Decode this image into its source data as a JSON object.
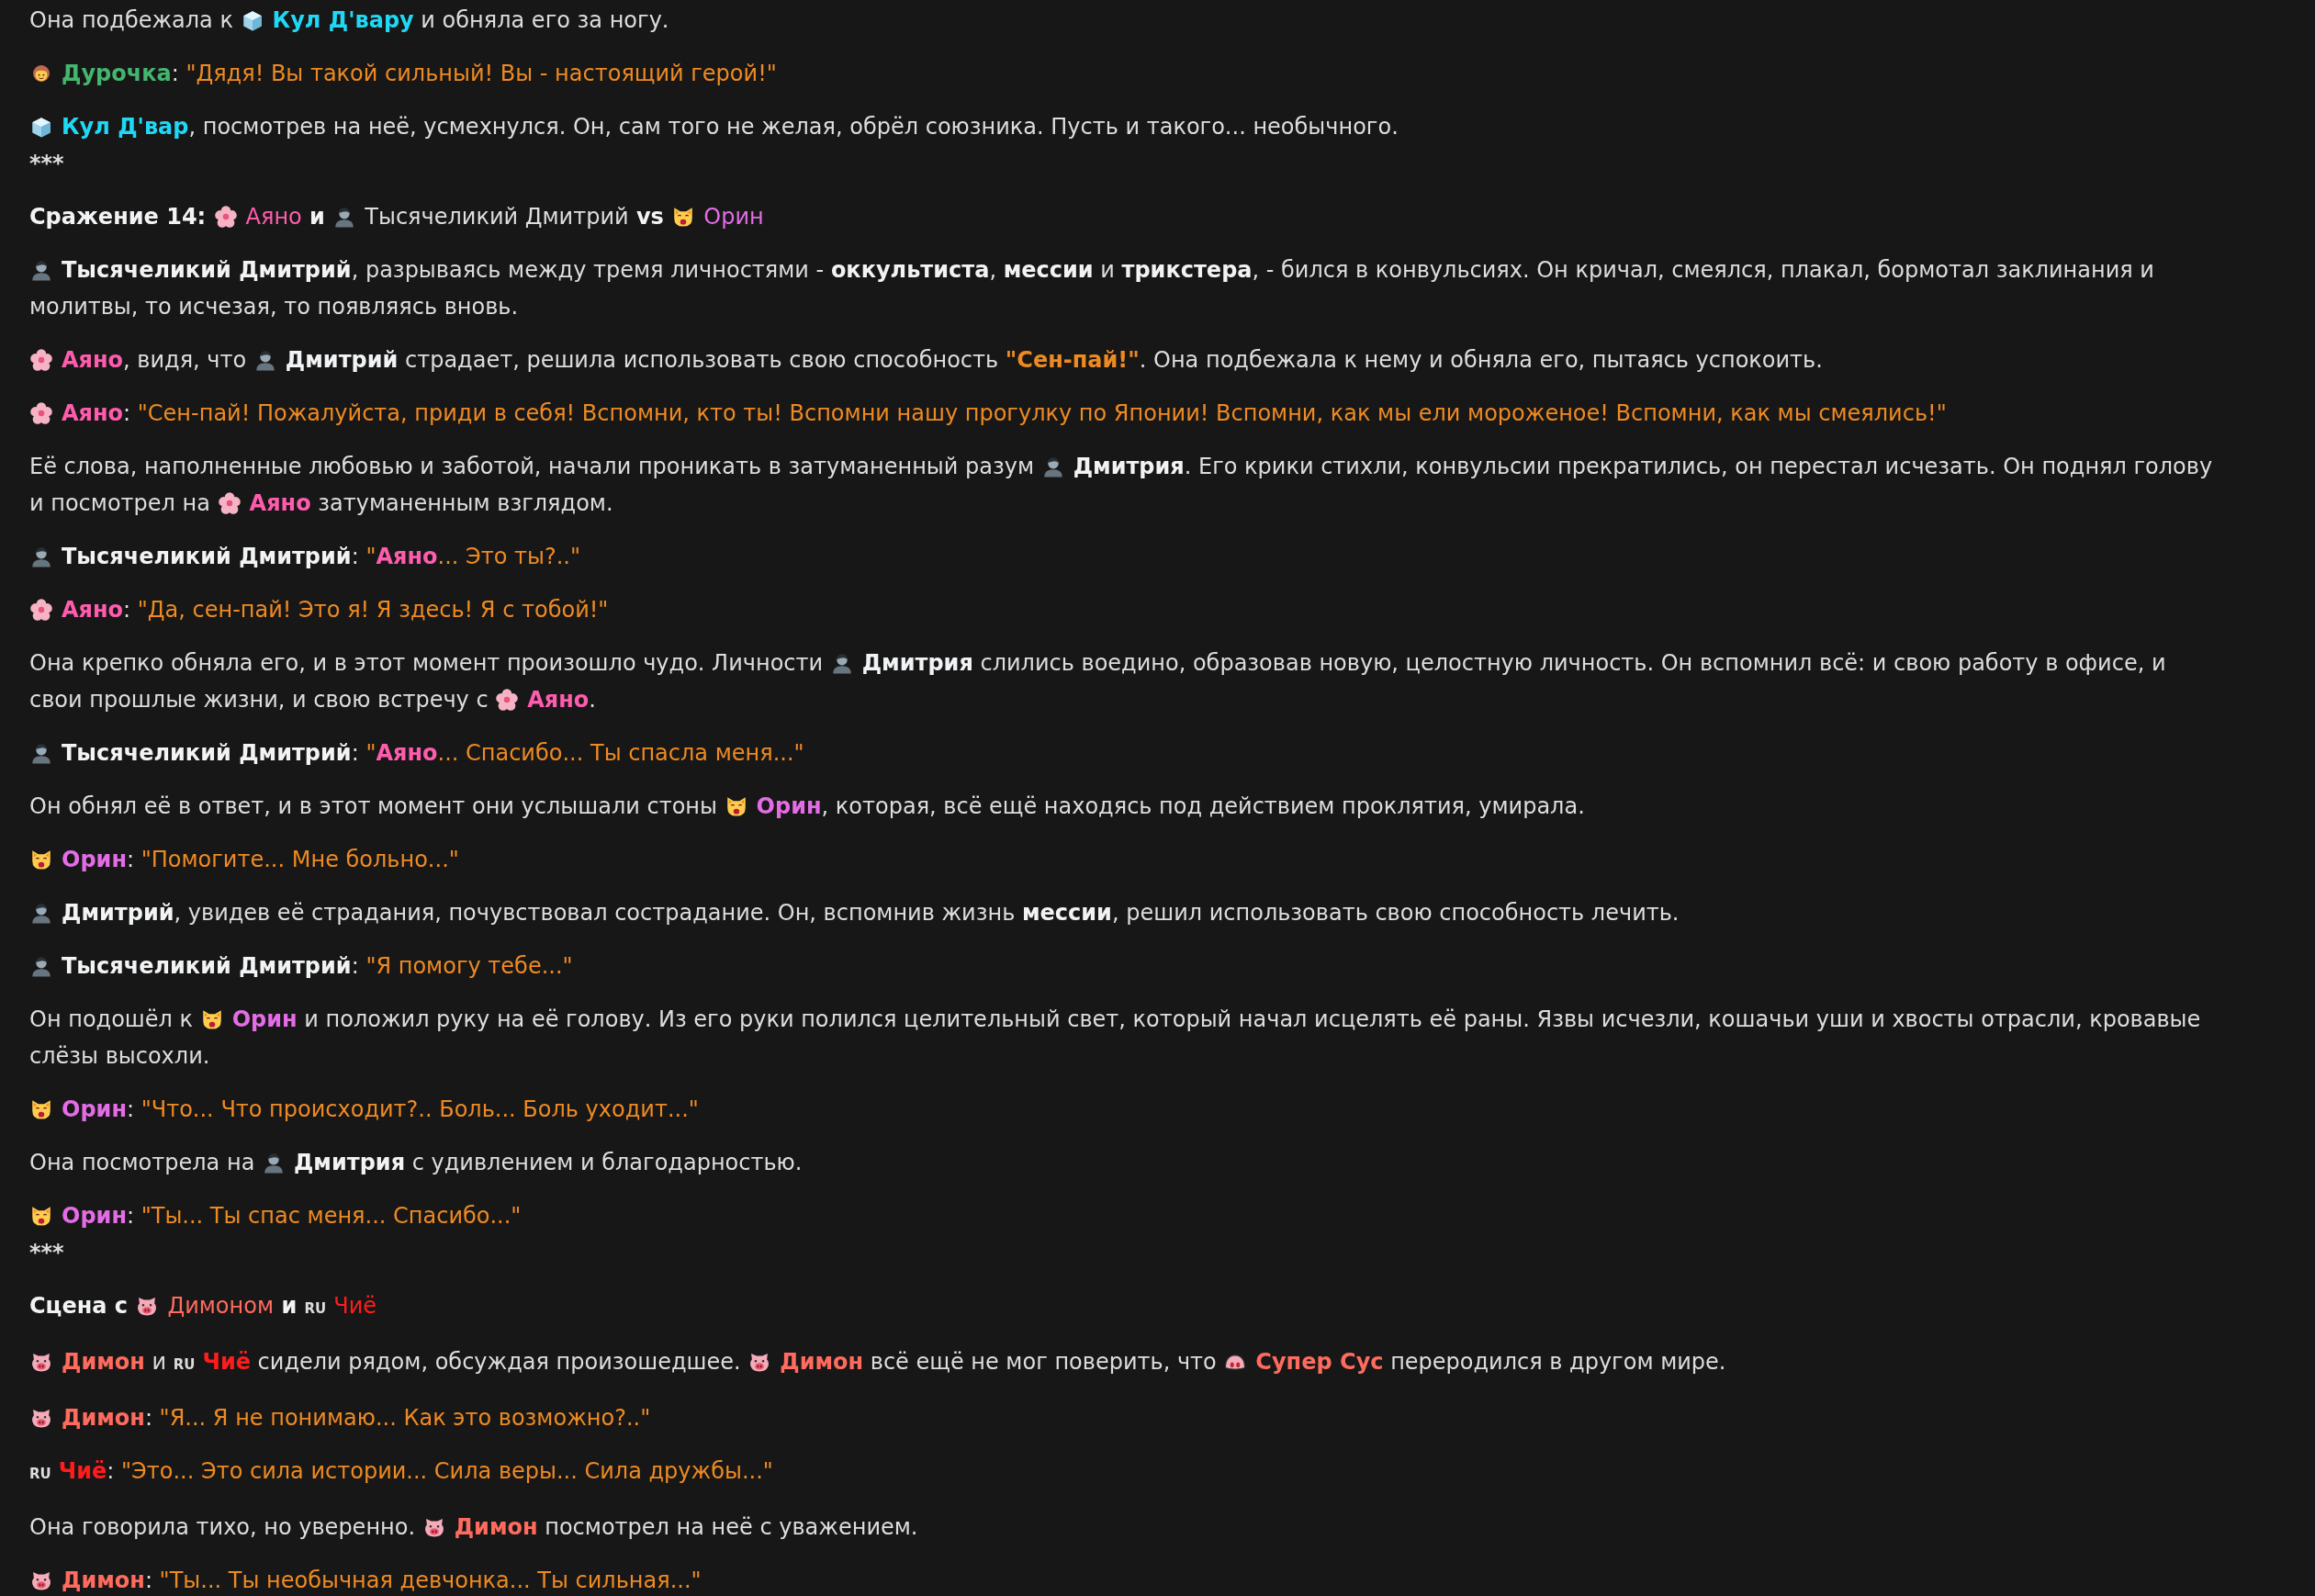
{
  "story": [
    {
      "kind": "paragraph",
      "lines": [
        [
          {
            "kind": "text",
            "text": "Она подбежала к "
          },
          {
            "kind": "ice"
          },
          {
            "kind": "name",
            "text": "Кул Д'вару",
            "color": "#1fd8f5"
          },
          {
            "kind": "text",
            "text": " и обняла его за ногу."
          }
        ]
      ]
    },
    {
      "kind": "paragraph",
      "lines": [
        [
          {
            "kind": "girl"
          },
          {
            "kind": "name",
            "text": "Дурочка",
            "color": "#43b66e"
          },
          {
            "kind": "text",
            "text": ": "
          },
          {
            "kind": "quote",
            "text": "\"Дядя! Вы такой сильный! Вы - настоящий герой!\""
          }
        ]
      ]
    },
    {
      "kind": "paragraph",
      "lines": [
        [
          {
            "kind": "ice"
          },
          {
            "kind": "name",
            "text": "Кул Д'вар",
            "color": "#1fd8f5"
          },
          {
            "kind": "text",
            "text": ", посмотрев на неё, усмехнулся. Он, сам того не желая, обрёл союзника. Пусть и такого... необычного."
          }
        ]
      ]
    },
    {
      "kind": "separator",
      "text": "***"
    },
    {
      "kind": "paragraph",
      "lines": [
        [
          {
            "kind": "bold",
            "text": "Сражение 14: "
          },
          {
            "kind": "blossom"
          },
          {
            "kind": "label",
            "text": "Аяно",
            "color": "#ff5cad"
          },
          {
            "kind": "bold",
            "text": " и "
          },
          {
            "kind": "person"
          },
          {
            "kind": "text",
            "text": "Тысячеликий Дмитрий"
          },
          {
            "kind": "bold",
            "text": " vs "
          },
          {
            "kind": "cat"
          },
          {
            "kind": "label",
            "text": "Орин",
            "color": "#e46ce6"
          }
        ]
      ]
    },
    {
      "kind": "paragraph",
      "lines": [
        [
          {
            "kind": "person"
          },
          {
            "kind": "bold",
            "text": "Тысячеликий Дмитрий"
          },
          {
            "kind": "text",
            "text": ", разрываясь между тремя личностями - "
          },
          {
            "kind": "bold",
            "text": "оккультиста"
          },
          {
            "kind": "text",
            "text": ", "
          },
          {
            "kind": "bold",
            "text": "мессии"
          },
          {
            "kind": "text",
            "text": " и "
          },
          {
            "kind": "bold",
            "text": "трикстера"
          },
          {
            "kind": "text",
            "text": ", - бился в конвульсиях. Он кричал, смеялся, плакал, бормотал заклинания и"
          }
        ],
        [
          {
            "kind": "text",
            "text": "молитвы, то исчезая, то появляясь вновь."
          }
        ]
      ]
    },
    {
      "kind": "paragraph",
      "lines": [
        [
          {
            "kind": "blossom"
          },
          {
            "kind": "name",
            "text": "Аяно",
            "color": "#ff5cad"
          },
          {
            "kind": "text",
            "text": ", видя, что "
          },
          {
            "kind": "person"
          },
          {
            "kind": "bold",
            "text": "Дмитрий"
          },
          {
            "kind": "text",
            "text": " страдает, решила использовать свою способность "
          },
          {
            "kind": "emphasis",
            "text": "\"Сен-пай!\""
          },
          {
            "kind": "text",
            "text": ". Она подбежала к нему и обняла его, пытаясь успокоить."
          }
        ]
      ]
    },
    {
      "kind": "paragraph",
      "lines": [
        [
          {
            "kind": "blossom"
          },
          {
            "kind": "name",
            "text": "Аяно",
            "color": "#ff5cad"
          },
          {
            "kind": "text",
            "text": ": "
          },
          {
            "kind": "quote",
            "text": "\"Сен-пай! Пожалуйста, приди в себя! Вспомни, кто ты! Вспомни нашу прогулку по Японии! Вспомни, как мы ели мороженое! Вспомни, как мы смеялись!\""
          }
        ]
      ]
    },
    {
      "kind": "paragraph",
      "lines": [
        [
          {
            "kind": "text",
            "text": "Её слова, наполненные любовью и заботой, начали проникать в затуманенный разум "
          },
          {
            "kind": "person"
          },
          {
            "kind": "bold",
            "text": "Дмитрия"
          },
          {
            "kind": "text",
            "text": ". Его крики стихли, конвульсии прекратились, он перестал исчезать. Он поднял голову"
          }
        ],
        [
          {
            "kind": "text",
            "text": "и посмотрел на "
          },
          {
            "kind": "blossom"
          },
          {
            "kind": "name",
            "text": "Аяно",
            "color": "#ff5cad"
          },
          {
            "kind": "text",
            "text": " затуманенным взглядом."
          }
        ]
      ]
    },
    {
      "kind": "paragraph",
      "lines": [
        [
          {
            "kind": "person"
          },
          {
            "kind": "bold",
            "text": "Тысячеликий Дмитрий"
          },
          {
            "kind": "text",
            "text": ": "
          },
          {
            "kind": "quote",
            "text": "\""
          },
          {
            "kind": "name",
            "text": "Аяно",
            "color": "#ff5cad"
          },
          {
            "kind": "quote",
            "text": "... Это ты?..\""
          }
        ]
      ]
    },
    {
      "kind": "paragraph",
      "lines": [
        [
          {
            "kind": "blossom"
          },
          {
            "kind": "name",
            "text": "Аяно",
            "color": "#ff5cad"
          },
          {
            "kind": "text",
            "text": ": "
          },
          {
            "kind": "quote",
            "text": "\"Да, сен-пай! Это я! Я здесь! Я с тобой!\""
          }
        ]
      ]
    },
    {
      "kind": "paragraph",
      "lines": [
        [
          {
            "kind": "text",
            "text": "Она крепко обняла его, и в этот момент произошло чудо. Личности "
          },
          {
            "kind": "person"
          },
          {
            "kind": "bold",
            "text": "Дмитрия"
          },
          {
            "kind": "text",
            "text": " слились воедино, образовав новую, целостную личность. Он вспомнил всё: и свою работу в офисе, и"
          }
        ],
        [
          {
            "kind": "text",
            "text": "свои прошлые жизни, и свою встречу с "
          },
          {
            "kind": "blossom"
          },
          {
            "kind": "name",
            "text": "Аяно",
            "color": "#ff5cad"
          },
          {
            "kind": "text",
            "text": "."
          }
        ]
      ]
    },
    {
      "kind": "paragraph",
      "lines": [
        [
          {
            "kind": "person"
          },
          {
            "kind": "bold",
            "text": "Тысячеликий Дмитрий"
          },
          {
            "kind": "text",
            "text": ": "
          },
          {
            "kind": "quote",
            "text": "\""
          },
          {
            "kind": "name",
            "text": "Аяно",
            "color": "#ff5cad"
          },
          {
            "kind": "quote",
            "text": "... Спасибо... Ты спасла меня...\""
          }
        ]
      ]
    },
    {
      "kind": "paragraph",
      "lines": [
        [
          {
            "kind": "text",
            "text": "Он обнял её в ответ, и в этот момент они услышали стоны "
          },
          {
            "kind": "cat"
          },
          {
            "kind": "name",
            "text": "Орин",
            "color": "#e46ce6"
          },
          {
            "kind": "text",
            "text": ", которая, всё ещё находясь под действием проклятия, умирала."
          }
        ]
      ]
    },
    {
      "kind": "paragraph",
      "lines": [
        [
          {
            "kind": "cat"
          },
          {
            "kind": "name",
            "text": "Орин",
            "color": "#e46ce6"
          },
          {
            "kind": "text",
            "text": ": "
          },
          {
            "kind": "quote",
            "text": "\"Помогите... Мне больно...\""
          }
        ]
      ]
    },
    {
      "kind": "paragraph",
      "lines": [
        [
          {
            "kind": "person"
          },
          {
            "kind": "bold",
            "text": "Дмитрий"
          },
          {
            "kind": "text",
            "text": ", увидев её страдания, почувствовал сострадание. Он, вспомнив жизнь "
          },
          {
            "kind": "bold",
            "text": "мессии"
          },
          {
            "kind": "text",
            "text": ", решил использовать свою способность лечить."
          }
        ]
      ]
    },
    {
      "kind": "paragraph",
      "lines": [
        [
          {
            "kind": "person"
          },
          {
            "kind": "bold",
            "text": "Тысячеликий Дмитрий"
          },
          {
            "kind": "text",
            "text": ": "
          },
          {
            "kind": "quote",
            "text": "\"Я помогу тебе...\""
          }
        ]
      ]
    },
    {
      "kind": "paragraph",
      "lines": [
        [
          {
            "kind": "text",
            "text": "Он подошёл к "
          },
          {
            "kind": "cat"
          },
          {
            "kind": "name",
            "text": "Орин",
            "color": "#e46ce6"
          },
          {
            "kind": "text",
            "text": " и положил руку на её голову. Из его руки полился целительный свет, который начал исцелять её раны. Язвы исчезли, кошачьи уши и хвосты отрасли, кровавые"
          }
        ],
        [
          {
            "kind": "text",
            "text": "слёзы высохли."
          }
        ]
      ]
    },
    {
      "kind": "paragraph",
      "lines": [
        [
          {
            "kind": "cat"
          },
          {
            "kind": "name",
            "text": "Орин",
            "color": "#e46ce6"
          },
          {
            "kind": "text",
            "text": ": "
          },
          {
            "kind": "quote",
            "text": "\"Что... Что происходит?.. Боль... Боль уходит...\""
          }
        ]
      ]
    },
    {
      "kind": "paragraph",
      "lines": [
        [
          {
            "kind": "text",
            "text": "Она посмотрела на "
          },
          {
            "kind": "person"
          },
          {
            "kind": "bold",
            "text": "Дмитрия"
          },
          {
            "kind": "text",
            "text": " с удивлением и благодарностью."
          }
        ]
      ]
    },
    {
      "kind": "paragraph",
      "lines": [
        [
          {
            "kind": "cat"
          },
          {
            "kind": "name",
            "text": "Орин",
            "color": "#e46ce6"
          },
          {
            "kind": "text",
            "text": ": "
          },
          {
            "kind": "quote",
            "text": "\"Ты... Ты спас меня... Спасибо...\""
          }
        ]
      ]
    },
    {
      "kind": "separator",
      "text": "***"
    },
    {
      "kind": "paragraph",
      "lines": [
        [
          {
            "kind": "bold",
            "text": "Сцена с "
          },
          {
            "kind": "pig"
          },
          {
            "kind": "label",
            "text": "Димоном",
            "color": "#ff6b5e"
          },
          {
            "kind": "bold",
            "text": " и "
          },
          {
            "kind": "tag",
            "text": "RU"
          },
          {
            "kind": "label",
            "text": "Чиё",
            "color": "#ff1c1c"
          }
        ]
      ]
    },
    {
      "kind": "paragraph",
      "lines": [
        [
          {
            "kind": "pig"
          },
          {
            "kind": "name",
            "text": "Димон",
            "color": "#ff6b5e"
          },
          {
            "kind": "text",
            "text": " и "
          },
          {
            "kind": "tag",
            "text": "RU"
          },
          {
            "kind": "name",
            "text": "Чиё",
            "color": "#ff1c1c"
          },
          {
            "kind": "text",
            "text": " сидели рядом, обсуждая произошедшее. "
          },
          {
            "kind": "pig"
          },
          {
            "kind": "name",
            "text": "Димон",
            "color": "#ff6b5e"
          },
          {
            "kind": "text",
            "text": " всё ещё не мог поверить, что "
          },
          {
            "kind": "nose"
          },
          {
            "kind": "name",
            "text": "Супер Сус",
            "color": "#ff6b5e"
          },
          {
            "kind": "text",
            "text": " переродился в другом мире."
          }
        ]
      ]
    },
    {
      "kind": "paragraph",
      "lines": [
        [
          {
            "kind": "pig"
          },
          {
            "kind": "name",
            "text": "Димон",
            "color": "#ff6b5e"
          },
          {
            "kind": "text",
            "text": ": "
          },
          {
            "kind": "quote",
            "text": "\"Я... Я не понимаю... Как это возможно?..\""
          }
        ]
      ]
    },
    {
      "kind": "paragraph",
      "lines": [
        [
          {
            "kind": "tag",
            "text": "RU"
          },
          {
            "kind": "name",
            "text": "Чиё",
            "color": "#ff1c1c"
          },
          {
            "kind": "text",
            "text": ": "
          },
          {
            "kind": "quote",
            "text": "\"Это... Это сила истории... Сила веры... Сила дружбы...\""
          }
        ]
      ]
    },
    {
      "kind": "paragraph",
      "lines": [
        [
          {
            "kind": "text",
            "text": "Она говорила тихо, но уверенно. "
          },
          {
            "kind": "pig"
          },
          {
            "kind": "name",
            "text": "Димон",
            "color": "#ff6b5e"
          },
          {
            "kind": "text",
            "text": " посмотрел на неё с уважением."
          }
        ]
      ]
    },
    {
      "kind": "paragraph",
      "lines": [
        [
          {
            "kind": "pig"
          },
          {
            "kind": "name",
            "text": "Димон",
            "color": "#ff6b5e"
          },
          {
            "kind": "text",
            "text": ": "
          },
          {
            "kind": "quote",
            "text": "\"Ты... Ты необычная девчонка... Ты сильная...\""
          }
        ]
      ]
    }
  ]
}
